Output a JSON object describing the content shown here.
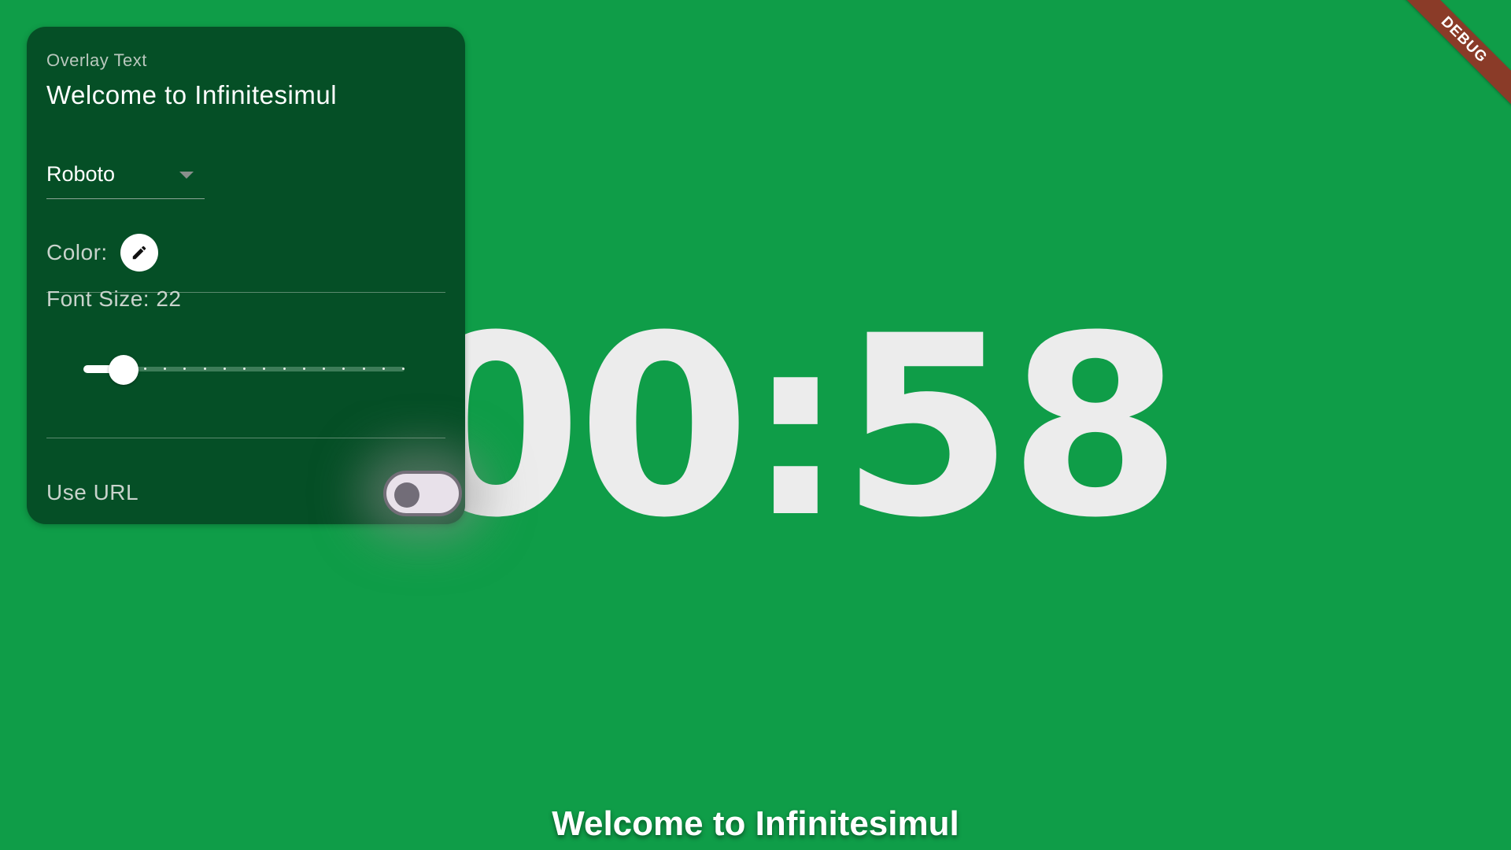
{
  "timer": {
    "display": "00:58"
  },
  "overlay_banner": {
    "text": "Welcome to Infinitesimul"
  },
  "debug_banner": {
    "label": "DEBUG"
  },
  "panel": {
    "overlay_label": "Overlay Text",
    "overlay_value": "Welcome to Infinitesimul",
    "font_select": {
      "selected": "Roboto"
    },
    "color": {
      "label": "Color:",
      "icon": "pencil-icon"
    },
    "font_size": {
      "label": "Font Size: ",
      "value": "22",
      "fraction": 0.11,
      "ticks": 16
    },
    "use_url": {
      "label": "Use URL",
      "enabled": false
    }
  },
  "colors": {
    "background": "#0f9d48",
    "panel": "#054f26",
    "timer_text": "#ececec",
    "debug_ribbon": "#8a3b28"
  }
}
